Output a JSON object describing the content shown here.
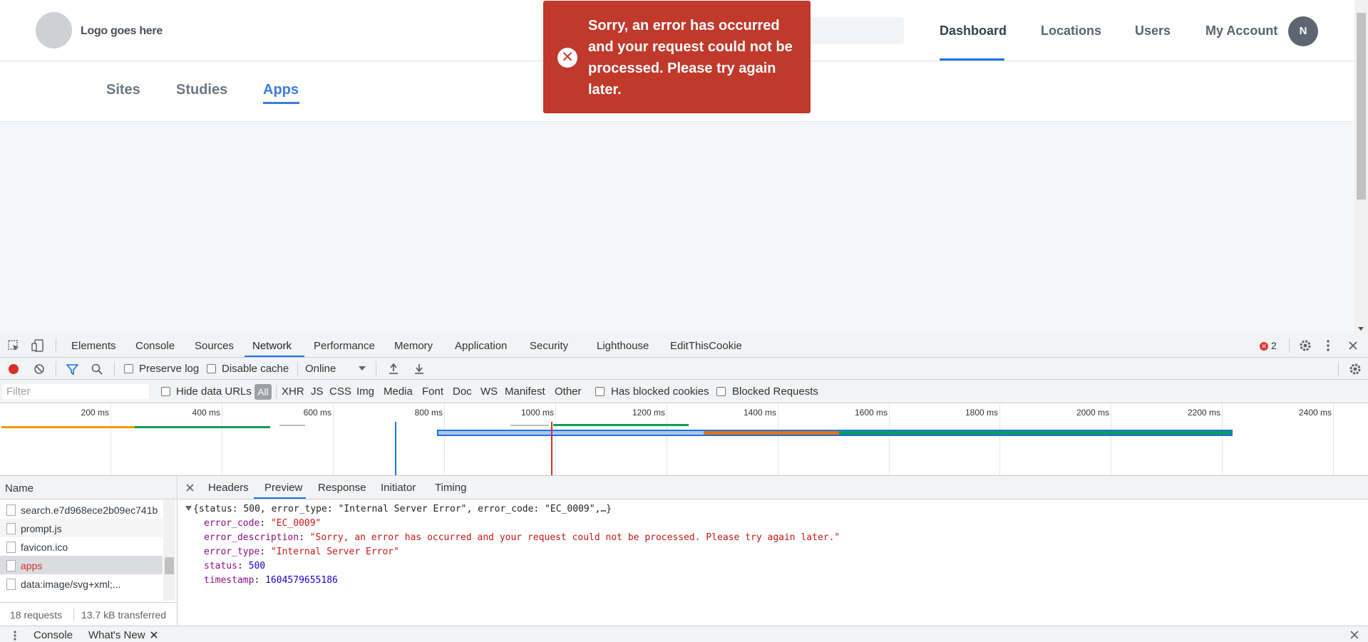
{
  "app": {
    "logo_text": "Logo goes here",
    "nav": [
      "Dashboard",
      "Locations",
      "Users",
      "My Account"
    ],
    "active_nav": "Dashboard",
    "avatar_initial": "N",
    "subnav": [
      "Sites",
      "Studies",
      "Apps"
    ],
    "active_subnav": "Apps",
    "toast": {
      "message": "Sorry, an error has occurred and your request could not be processed. Please try again later."
    },
    "colors": {
      "accent": "#1a73e8",
      "error": "#c0392b",
      "subnav_active": "#3b7ddd"
    }
  },
  "devtools": {
    "tabs": [
      "Elements",
      "Console",
      "Sources",
      "Network",
      "Performance",
      "Memory",
      "Application",
      "Security",
      "Lighthouse",
      "EditThisCookie"
    ],
    "active_tab": "Network",
    "error_count": "2",
    "toolbar": {
      "preserve_log": "Preserve log",
      "disable_cache": "Disable cache",
      "throttle": "Online"
    },
    "filter": {
      "placeholder": "Filter",
      "hide_data_urls": "Hide data URLs",
      "all": "All",
      "types": [
        "XHR",
        "JS",
        "CSS",
        "Img",
        "Media",
        "Font",
        "Doc",
        "WS",
        "Manifest",
        "Other"
      ],
      "has_blocked_cookies": "Has blocked cookies",
      "blocked_requests": "Blocked Requests"
    },
    "overview_ticks": [
      "200 ms",
      "400 ms",
      "600 ms",
      "800 ms",
      "1000 ms",
      "1200 ms",
      "1400 ms",
      "1600 ms",
      "1800 ms",
      "2000 ms",
      "2200 ms",
      "2400 ms"
    ],
    "name_header": "Name",
    "requests": [
      {
        "name": "search.e7d968ece2b09ec741b",
        "error": false
      },
      {
        "name": "prompt.js",
        "error": false
      },
      {
        "name": "favicon.ico",
        "error": false
      },
      {
        "name": "apps",
        "error": true
      },
      {
        "name": "data:image/svg+xml;...",
        "error": false
      }
    ],
    "summary": {
      "requests": "18 requests",
      "transferred": "13.7 kB transferred"
    },
    "detail_tabs": [
      "Headers",
      "Preview",
      "Response",
      "Initiator",
      "Timing"
    ],
    "active_detail_tab": "Preview",
    "preview": {
      "summary": "{status: 500, error_type: \"Internal Server Error\", error_code: \"EC_0009\",…}",
      "fields": [
        {
          "key": "error_code",
          "value": "\"EC_0009\"",
          "kind": "string"
        },
        {
          "key": "error_description",
          "value": "\"Sorry, an error has occurred and your request could not be processed. Please try again later.\"",
          "kind": "string"
        },
        {
          "key": "error_type",
          "value": "\"Internal Server Error\"",
          "kind": "string"
        },
        {
          "key": "status",
          "value": "500",
          "kind": "number"
        },
        {
          "key": "timestamp",
          "value": "1604579655186",
          "kind": "number"
        }
      ]
    },
    "drawer_tabs": [
      "Console",
      "What's New"
    ]
  }
}
